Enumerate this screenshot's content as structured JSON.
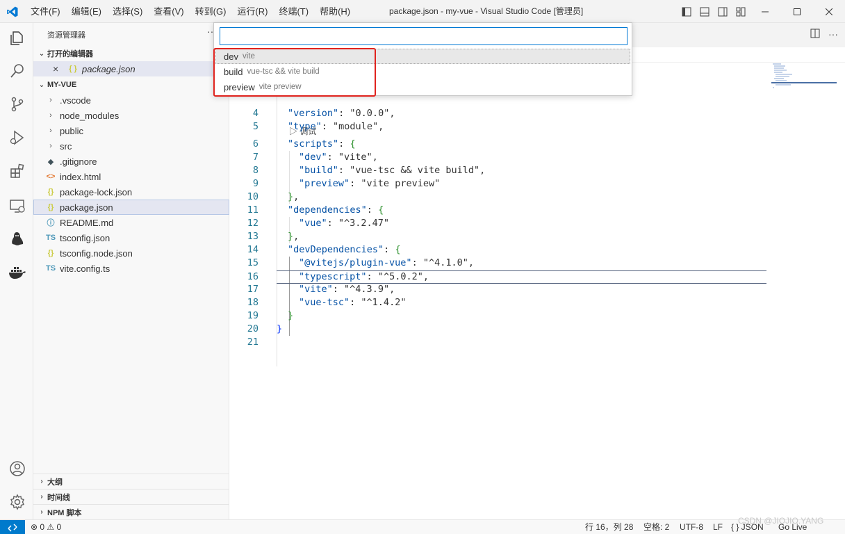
{
  "window": {
    "title": "package.json - my-vue - Visual Studio Code [管理员]",
    "menu": [
      "文件(F)",
      "编辑(E)",
      "选择(S)",
      "查看(V)",
      "转到(G)",
      "运行(R)",
      "终端(T)",
      "帮助(H)"
    ]
  },
  "activity_bar": {
    "icons": [
      "explorer-icon",
      "search-icon",
      "source-control-icon",
      "run-debug-icon",
      "extensions-icon",
      "remote-explorer-icon",
      "linux-penguin-icon",
      "docker-icon",
      "account-icon",
      "settings-gear-icon"
    ]
  },
  "sidebar": {
    "title": "资源管理器",
    "more": "···",
    "open_editors_header": "打开的编辑器",
    "open_editors": [
      {
        "name": "package.json",
        "close": "×",
        "icon": "{ }"
      }
    ],
    "project_header": "MY-VUE",
    "tree": [
      {
        "name": ".vscode",
        "type": "folder"
      },
      {
        "name": "node_modules",
        "type": "folder"
      },
      {
        "name": "public",
        "type": "folder"
      },
      {
        "name": "src",
        "type": "folder"
      },
      {
        "name": ".gitignore",
        "type": "file",
        "icon": "◆",
        "color": "#41535b"
      },
      {
        "name": "index.html",
        "type": "file",
        "icon": "<>",
        "color": "#e37933"
      },
      {
        "name": "package-lock.json",
        "type": "file",
        "icon": "{}",
        "color": "#cbcb41"
      },
      {
        "name": "package.json",
        "type": "file",
        "icon": "{}",
        "color": "#cbcb41",
        "selected": true
      },
      {
        "name": "README.md",
        "type": "file",
        "icon": "ⓘ",
        "color": "#519aba"
      },
      {
        "name": "tsconfig.json",
        "type": "file",
        "icon": "TS",
        "color": "#519aba"
      },
      {
        "name": "tsconfig.node.json",
        "type": "file",
        "icon": "{}",
        "color": "#cbcb41"
      },
      {
        "name": "vite.config.ts",
        "type": "file",
        "icon": "TS",
        "color": "#519aba"
      }
    ],
    "bottom_sections": [
      "大纲",
      "时间线",
      "NPM 脚本"
    ]
  },
  "quick_pick": {
    "input_value": "",
    "items": [
      {
        "label": "dev",
        "description": "vite",
        "active": true
      },
      {
        "label": "build",
        "description": "vue-tsc && vite build",
        "active": false
      },
      {
        "label": "preview",
        "description": "vite preview",
        "active": false
      }
    ]
  },
  "editor": {
    "codelens": "▷ 调试",
    "lines": [
      {
        "n": "4",
        "code": "\"version\": \"0.0.0\","
      },
      {
        "n": "5",
        "code": "\"type\": \"module\","
      },
      {
        "n": "6",
        "code": "\"scripts\": {"
      },
      {
        "n": "7",
        "code": "\"dev\": \"vite\","
      },
      {
        "n": "8",
        "code": "\"build\": \"vue-tsc && vite build\","
      },
      {
        "n": "9",
        "code": "\"preview\": \"vite preview\""
      },
      {
        "n": "10",
        "code": "},"
      },
      {
        "n": "11",
        "code": "\"dependencies\": {"
      },
      {
        "n": "12",
        "code": "\"vue\": \"^3.2.47\""
      },
      {
        "n": "13",
        "code": "},"
      },
      {
        "n": "14",
        "code": "\"devDependencies\": {"
      },
      {
        "n": "15",
        "code": "\"@vitejs/plugin-vue\": \"^4.1.0\","
      },
      {
        "n": "16",
        "code": "\"typescript\": \"^5.0.2\","
      },
      {
        "n": "17",
        "code": "\"vite\": \"^4.3.9\","
      },
      {
        "n": "18",
        "code": "\"vue-tsc\": \"^1.4.2\""
      },
      {
        "n": "19",
        "code": "}"
      },
      {
        "n": "20",
        "code": "}"
      },
      {
        "n": "21",
        "code": ""
      }
    ]
  },
  "status_bar": {
    "problems": "⊗ 0 ⚠ 0",
    "position": "行 16，列 28",
    "indent": "空格: 2",
    "encoding": "UTF-8",
    "eol": "LF",
    "language": "{ } JSON",
    "go_live": "Go Live"
  },
  "watermark": "CSDN @JIOJIO.YANG"
}
